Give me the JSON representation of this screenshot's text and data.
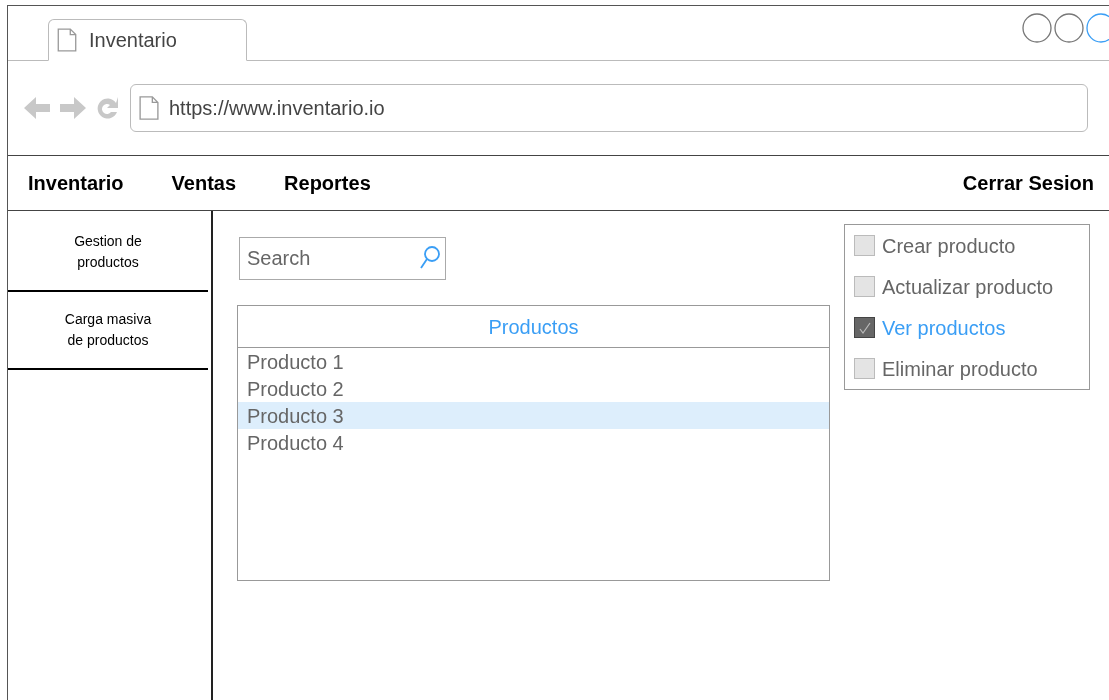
{
  "browser": {
    "tab_title": "Inventario",
    "url": "https://www.inventario.io"
  },
  "nav": {
    "items": [
      {
        "label": "Inventario"
      },
      {
        "label": "Ventas"
      },
      {
        "label": "Reportes"
      }
    ],
    "logout": "Cerrar Sesion"
  },
  "sidebar": {
    "items": [
      {
        "label": "Gestion de productos"
      },
      {
        "label": "Carga masiva de productos"
      }
    ]
  },
  "search": {
    "placeholder": "Search"
  },
  "list": {
    "title": "Productos",
    "rows": [
      {
        "label": "Producto 1",
        "selected": false
      },
      {
        "label": "Producto 2",
        "selected": false
      },
      {
        "label": "Producto 3",
        "selected": true
      },
      {
        "label": "Producto 4",
        "selected": false
      }
    ]
  },
  "permissions": [
    {
      "label": "Crear producto",
      "checked": false
    },
    {
      "label": "Actualizar producto",
      "checked": false
    },
    {
      "label": "Ver productos",
      "checked": true
    },
    {
      "label": "Eliminar producto",
      "checked": false
    }
  ]
}
